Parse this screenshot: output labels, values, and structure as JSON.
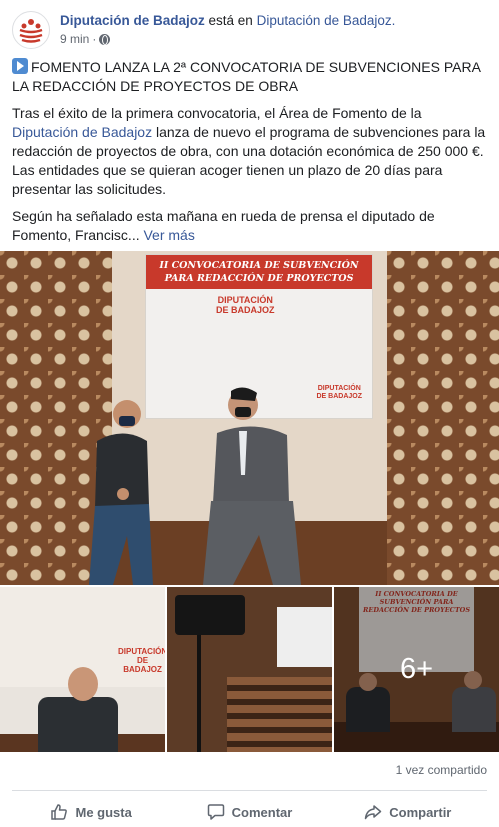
{
  "header": {
    "page_name": "Diputación de Badajoz",
    "connector": "está en",
    "place_name": "Diputación de Badajoz.",
    "time": "9 min",
    "dot": "·",
    "privacy_icon": "globe-icon"
  },
  "post": {
    "title": "FOMENTO LANZA LA 2ª CONVOCATORIA DE SUBVENCIONES PARA LA REDACCIÓN DE PROYECTOS DE OBRA",
    "title_icon": "play-button-emoji",
    "para1_before_link": "Tras el éxito de la primera convocatoria, el Área de Fomento de la ",
    "para1_link": "Diputación de Badajoz",
    "para1_after_link": " lanza de nuevo el programa de subvenciones para la redacción de proyectos de obra, con una dotación económica de 250 000 €. Las entidades que se quieran acoger tienen un plazo de 20 días para presentar las solicitudes.",
    "para2": "Según ha señalado esta mañana en rueda de prensa el diputado de Fomento, Francisc...",
    "see_more": "Ver más"
  },
  "photos": {
    "main_screen_title": "II CONVOCATORIA DE SUBVENCIÓN PARA REDACCIÓN DE PROYECTOS",
    "main_screen_logo_line1": "DIPUTACIÓN",
    "main_screen_logo_line2": "DE BADAJOZ",
    "thumb3_screen_title": "II CONVOCATORIA DE SUBVENCIÓN PARA REDACCIÓN DE PROYECTOS",
    "more_count": "6+"
  },
  "footer": {
    "share_count": "1 vez compartido",
    "like_label": "Me gusta",
    "comment_label": "Comentar",
    "share_label": "Compartir"
  },
  "colors": {
    "link": "#385898",
    "brand_red": "#c8392b",
    "muted": "#606770"
  }
}
